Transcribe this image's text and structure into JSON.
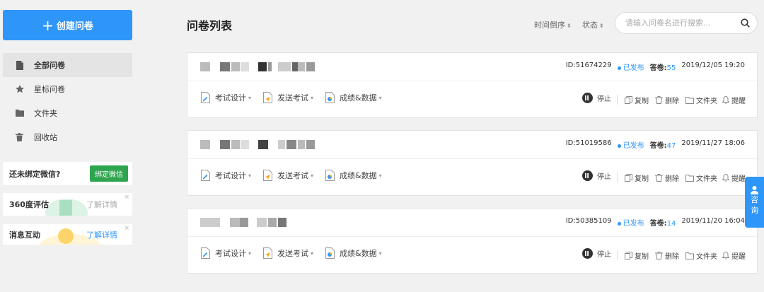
{
  "sidebar": {
    "create_label": "创建问卷",
    "items": [
      {
        "label": "全部问卷",
        "icon": "document-icon",
        "active": true
      },
      {
        "label": "星标问卷",
        "icon": "star-icon",
        "active": false
      },
      {
        "label": "文件夹",
        "icon": "folder-icon",
        "active": false
      },
      {
        "label": "回收站",
        "icon": "trash-icon",
        "active": false
      }
    ],
    "wechat_prompt": "还未绑定微信?",
    "wechat_button": "绑定微信",
    "promo_360": {
      "title": "360度评估",
      "link": "了解详情"
    },
    "promo_message": {
      "title": "消息互动",
      "link": "了解详情"
    },
    "close_glyph": "×"
  },
  "header": {
    "title": "问卷列表",
    "sort_time": "时间倒序",
    "sort_status": "状态",
    "sort_arrow": "⬍",
    "search_placeholder": "请输入问卷名进行搜索..."
  },
  "toolbar_labels": {
    "design": "考试设计",
    "send": "发送考试",
    "results": "成绩&数据",
    "dropdown_arrow": "▾",
    "stop": "停止",
    "copy": "复制",
    "delete": "删除",
    "folder": "文件夹",
    "remind": "提醒"
  },
  "surveys": [
    {
      "id_text": "ID:51674229",
      "status": "已发布",
      "answers_label": "答卷:",
      "answers": "55",
      "datetime": "2019/12/05 19:20"
    },
    {
      "id_text": "ID:51019586",
      "status": "已发布",
      "answers_label": "答卷:",
      "answers": "47",
      "datetime": "2019/11/27 18:06"
    },
    {
      "id_text": "ID:50385109",
      "status": "已发布",
      "answers_label": "答卷:",
      "answers": "14",
      "datetime": "2019/11/20 16:04"
    }
  ],
  "consult": {
    "chars": [
      "咨",
      "询"
    ]
  },
  "colors": {
    "accent": "#2f96f9",
    "green": "#2ea44f",
    "background": "#f1f1f1"
  }
}
